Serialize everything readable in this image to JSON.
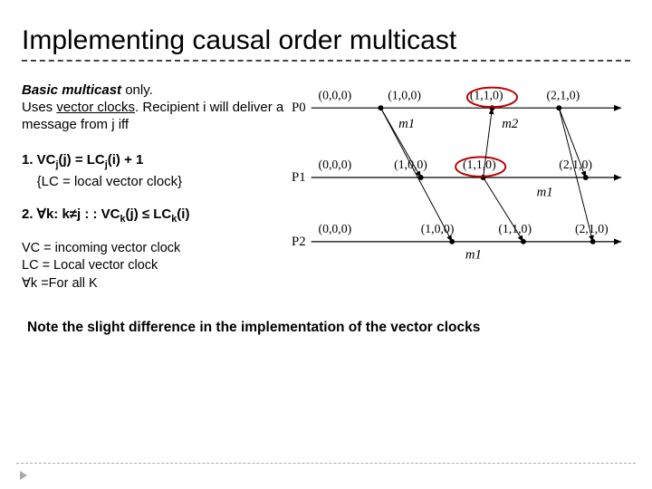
{
  "title": "Implementing causal order multicast",
  "intro": {
    "lead_italic": "Basic multicast",
    "lead_rest": " only.",
    "line2a": "Uses ",
    "line2_ul": "vector clocks",
    "line2b": ". Recipient i will deliver a message from j iff"
  },
  "rule1": {
    "prefix": "1. VC",
    "sub_j1": "j",
    "mid1": "(j) =  LC",
    "sub_j2": "j",
    "mid2": "(i) + 1",
    "sub_line": "{LC = local vector clock}"
  },
  "rule2": {
    "prefix": "2. ∀k: k≠j : : VC",
    "sub_k1": "k",
    "mid": "(j) ≤ LC",
    "sub_k2": "k",
    "tail": "(i)"
  },
  "defs": {
    "d1": "VC = incoming vector clock",
    "d2": "LC = Local vector clock",
    "d3": "∀k =For all K"
  },
  "footnote": "Note the slight difference in the implementation of the vector clocks",
  "diagram": {
    "processes": [
      "P0",
      "P1",
      "P2"
    ],
    "p0_values": [
      "(0,0,0)",
      "(1,0,0)",
      "(1,1,0)",
      "(2,1,0)"
    ],
    "p1_values": [
      "(0,0,0)",
      "(1,0,0)",
      "(1,1,0)",
      "(2,1,0)"
    ],
    "p2_values": [
      "(0,0,0)",
      "(1,0,0)",
      "(1,1,0)",
      "(2,1,0)"
    ],
    "p0_msgs": [
      "m1",
      "m2"
    ],
    "p1_msgs": [
      "m1"
    ],
    "p2_msgs": [
      "m1"
    ]
  }
}
